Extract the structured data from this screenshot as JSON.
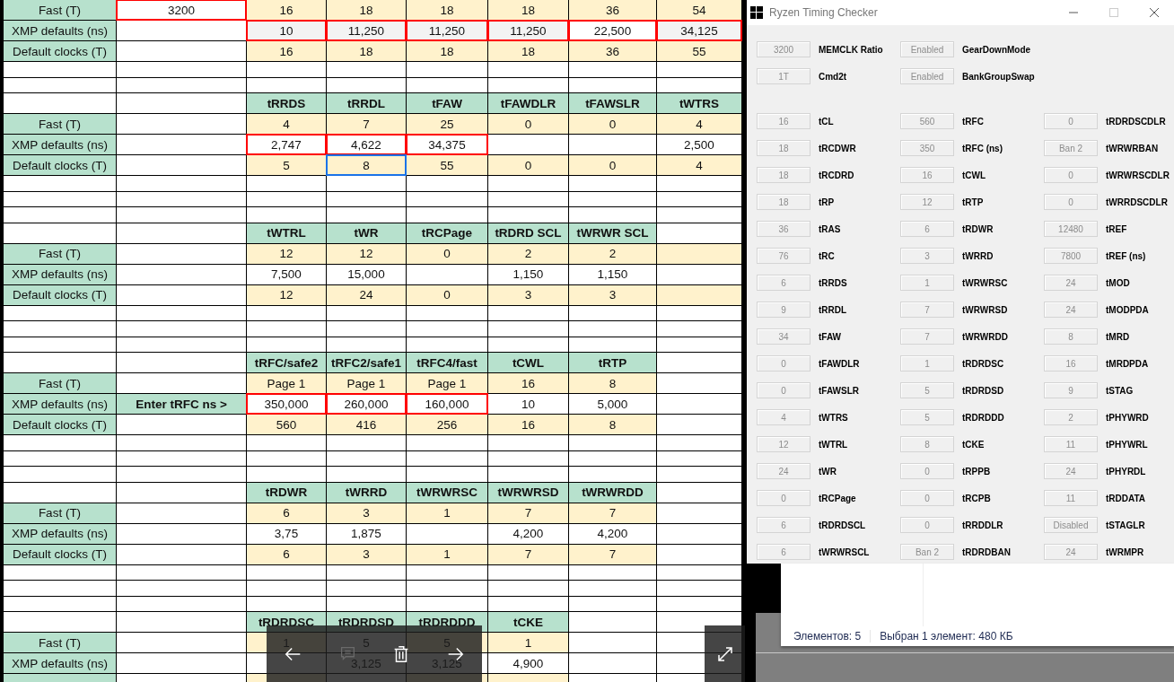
{
  "spreadsheet": {
    "blocks": [
      {
        "rows": [
          {
            "label": "Fast (T)",
            "cells": [
              {
                "text": "3200",
                "outlined": true,
                "selected": false
              },
              {
                "text": "16",
                "color": "#fff2cc",
                "outlined": false,
                "selected": false
              },
              {
                "text": "18",
                "color": "#fff2cc",
                "outlined": false,
                "selected": false
              },
              {
                "text": "18",
                "color": "#fff2cc",
                "outlined": false,
                "selected": false
              },
              {
                "text": "18",
                "color": "#fff2cc",
                "outlined": false,
                "selected": false
              },
              {
                "text": "36",
                "color": "#fff2cc",
                "outlined": false,
                "selected": false
              },
              {
                "text": "54",
                "color": "#fff2cc",
                "outlined": false,
                "selected": false
              }
            ]
          },
          {
            "label": "XMP defaults (ns)",
            "cells": [
              {
                "outlined": false,
                "selected": false
              },
              {
                "text": "10",
                "color": "#f3f3f3",
                "outlined": true,
                "selected": false
              },
              {
                "text": "11,250",
                "color": "#f3f3f3",
                "outlined": true,
                "selected": false
              },
              {
                "text": "11,250",
                "color": "#f3f3f3",
                "outlined": true,
                "selected": false
              },
              {
                "text": "11,250",
                "color": "#f3f3f3",
                "outlined": true,
                "selected": false
              },
              {
                "text": "22,500",
                "outlined": true,
                "selected": false
              },
              {
                "text": "34,125",
                "color": "#f3f3f3",
                "outlined": true,
                "selected": false
              }
            ]
          },
          {
            "label": "Default clocks (T)",
            "cells": [
              {
                "outlined": false,
                "selected": false
              },
              {
                "text": "16",
                "color": "#fff2cc",
                "outlined": false,
                "selected": false
              },
              {
                "text": "18",
                "color": "#fff2cc",
                "outlined": false,
                "selected": false
              },
              {
                "text": "18",
                "color": "#fff2cc",
                "outlined": false,
                "selected": false
              },
              {
                "text": "18",
                "color": "#fff2cc",
                "outlined": false,
                "selected": false
              },
              {
                "text": "36",
                "color": "#fff2cc",
                "outlined": false,
                "selected": false
              },
              {
                "text": "55",
                "color": "#fff2cc",
                "outlined": false,
                "selected": false
              }
            ]
          },
          {
            "kind": "blank"
          },
          {
            "kind": "blank"
          }
        ]
      },
      {
        "headers": [
          "tRRDS",
          "tRRDL",
          "tFAW",
          "tFAWDLR",
          "tFAWSLR",
          "tWTRS"
        ],
        "rows": [
          {
            "label": "Fast (T)",
            "cells": [
              {
                "outlined": false,
                "selected": false
              },
              {
                "text": "4",
                "color": "#fff2cc",
                "outlined": false,
                "selected": false
              },
              {
                "text": "7",
                "color": "#fff2cc",
                "outlined": false,
                "selected": false
              },
              {
                "text": "25",
                "color": "#fff2cc",
                "outlined": false,
                "selected": false
              },
              {
                "text": "0",
                "color": "#fff2cc",
                "outlined": false,
                "selected": false
              },
              {
                "text": "0",
                "color": "#fff2cc",
                "outlined": false,
                "selected": false
              },
              {
                "text": "4",
                "color": "#fff2cc",
                "outlined": false,
                "selected": false
              }
            ]
          },
          {
            "label": "XMP defaults (ns)",
            "cells": [
              {
                "outlined": false,
                "selected": false
              },
              {
                "text": "2,747",
                "outlined": true,
                "selected": false
              },
              {
                "text": "4,622",
                "outlined": true,
                "selected": false
              },
              {
                "text": "34,375",
                "outlined": true,
                "selected": false
              },
              {
                "outlined": false,
                "selected": false
              },
              {
                "outlined": false,
                "selected": false
              },
              {
                "text": "2,500",
                "outlined": false,
                "selected": false
              }
            ]
          },
          {
            "label": "Default clocks (T)",
            "cells": [
              {
                "outlined": false,
                "selected": false
              },
              {
                "text": "5",
                "color": "#fff2cc",
                "outlined": false,
                "selected": false
              },
              {
                "text": "8",
                "color": "#fff2cc",
                "outlined": false,
                "selected": true
              },
              {
                "text": "55",
                "color": "#fff2cc",
                "outlined": false,
                "selected": false
              },
              {
                "text": "0",
                "color": "#fff2cc",
                "outlined": false,
                "selected": false
              },
              {
                "text": "0",
                "color": "#fff2cc",
                "outlined": false,
                "selected": false
              },
              {
                "text": "4",
                "color": "#fff2cc",
                "outlined": false,
                "selected": false
              }
            ]
          },
          {
            "kind": "blank"
          },
          {
            "kind": "blank"
          },
          {
            "kind": "blank"
          }
        ]
      },
      {
        "headers": [
          "tWTRL",
          "tWR",
          "tRCPage",
          "tRDRD SCL",
          "tWRWR SCL"
        ],
        "rows": [
          {
            "label": "Fast (T)",
            "cells": [
              {
                "outlined": false,
                "selected": false
              },
              {
                "text": "12",
                "color": "#fff2cc",
                "outlined": false,
                "selected": false
              },
              {
                "text": "12",
                "color": "#fff2cc",
                "outlined": false,
                "selected": false
              },
              {
                "text": "0",
                "color": "#fff2cc",
                "outlined": false,
                "selected": false
              },
              {
                "text": "2",
                "color": "#fff2cc",
                "outlined": false,
                "selected": false
              },
              {
                "text": "2",
                "color": "#fff2cc",
                "outlined": false,
                "selected": false
              },
              {
                "color": "#fff2cc",
                "outlined": false,
                "selected": false
              }
            ]
          },
          {
            "label": "XMP defaults (ns)",
            "cells": [
              {
                "outlined": false,
                "selected": false
              },
              {
                "text": "7,500",
                "outlined": false,
                "selected": false
              },
              {
                "text": "15,000",
                "outlined": false,
                "selected": false
              },
              {
                "outlined": false,
                "selected": false
              },
              {
                "text": "1,150",
                "outlined": false,
                "selected": false
              },
              {
                "text": "1,150",
                "outlined": false,
                "selected": false
              },
              {
                "outlined": false,
                "selected": false
              }
            ]
          },
          {
            "label": "Default clocks (T)",
            "cells": [
              {
                "outlined": false,
                "selected": false
              },
              {
                "text": "12",
                "color": "#fff2cc",
                "outlined": false,
                "selected": false
              },
              {
                "text": "24",
                "color": "#fff2cc",
                "outlined": false,
                "selected": false
              },
              {
                "text": "0",
                "color": "#fff2cc",
                "outlined": false,
                "selected": false
              },
              {
                "text": "3",
                "color": "#fff2cc",
                "outlined": false,
                "selected": false
              },
              {
                "text": "3",
                "color": "#fff2cc",
                "outlined": false,
                "selected": false
              },
              {
                "color": "#fff2cc",
                "outlined": false,
                "selected": false
              }
            ]
          },
          {
            "kind": "blank"
          },
          {
            "kind": "blank"
          },
          {
            "kind": "blank"
          }
        ]
      },
      {
        "headers": [
          "tRFC/safe2",
          "tRFC2/safe1",
          "tRFC4/fast",
          "tCWL",
          "tRTP"
        ],
        "rows": [
          {
            "label": "Fast (T)",
            "cells": [
              {
                "outlined": false,
                "selected": false
              },
              {
                "text": "Page 1",
                "color": "#fff2cc",
                "outlined": false,
                "selected": false
              },
              {
                "text": "Page 1",
                "color": "#fff2cc",
                "outlined": false,
                "selected": false
              },
              {
                "text": "Page 1",
                "color": "#fff2cc",
                "outlined": false,
                "selected": false
              },
              {
                "text": "16",
                "color": "#fff2cc",
                "outlined": false,
                "selected": false
              },
              {
                "text": "8",
                "color": "#fff2cc",
                "outlined": false,
                "selected": false
              },
              {
                "outlined": false,
                "selected": false
              }
            ]
          },
          {
            "label": "XMP defaults (ns)",
            "cells": [
              {
                "text": "Enter tRFC ns >",
                "color": "#b7e1cd",
                "outlined": false,
                "selected": false
              },
              {
                "text": "350,000",
                "outlined": true,
                "selected": false
              },
              {
                "text": "260,000",
                "outlined": true,
                "selected": false
              },
              {
                "text": "160,000",
                "outlined": true,
                "selected": false
              },
              {
                "text": "10",
                "outlined": false,
                "selected": false
              },
              {
                "text": "5,000",
                "outlined": false,
                "selected": false
              },
              {
                "outlined": false,
                "selected": false
              }
            ]
          },
          {
            "label": "Default clocks (T)",
            "cells": [
              {
                "outlined": false,
                "selected": false
              },
              {
                "text": "560",
                "color": "#fff2cc",
                "outlined": false,
                "selected": false
              },
              {
                "text": "416",
                "color": "#fff2cc",
                "outlined": false,
                "selected": false
              },
              {
                "text": "256",
                "color": "#fff2cc",
                "outlined": false,
                "selected": false
              },
              {
                "text": "16",
                "color": "#fff2cc",
                "outlined": false,
                "selected": false
              },
              {
                "text": "8",
                "color": "#fff2cc",
                "outlined": false,
                "selected": false
              },
              {
                "outlined": false,
                "selected": false
              }
            ]
          },
          {
            "kind": "blank"
          },
          {
            "kind": "blank"
          },
          {
            "kind": "blank"
          }
        ]
      },
      {
        "headers": [
          "tRDWR",
          "tWRRD",
          "tWRWRSC",
          "tWRWRSD",
          "tWRWRDD"
        ],
        "rows": [
          {
            "label": "Fast (T)",
            "cells": [
              {
                "outlined": false,
                "selected": false
              },
              {
                "text": "6",
                "color": "#fff2cc",
                "outlined": false,
                "selected": false
              },
              {
                "text": "3",
                "color": "#fff2cc",
                "outlined": false,
                "selected": false
              },
              {
                "text": "1",
                "color": "#fff2cc",
                "outlined": false,
                "selected": false
              },
              {
                "text": "7",
                "color": "#fff2cc",
                "outlined": false,
                "selected": false
              },
              {
                "text": "7",
                "color": "#fff2cc",
                "outlined": false,
                "selected": false
              },
              {
                "outlined": false,
                "selected": false
              }
            ]
          },
          {
            "label": "XMP defaults (ns)",
            "cells": [
              {
                "outlined": false,
                "selected": false
              },
              {
                "text": "3,75",
                "outlined": false,
                "selected": false
              },
              {
                "text": "1,875",
                "outlined": false,
                "selected": false
              },
              {
                "outlined": false,
                "selected": false
              },
              {
                "text": "4,200",
                "outlined": false,
                "selected": false
              },
              {
                "text": "4,200",
                "outlined": false,
                "selected": false
              },
              {
                "outlined": false,
                "selected": false
              }
            ]
          },
          {
            "label": "Default clocks (T)",
            "cells": [
              {
                "outlined": false,
                "selected": false
              },
              {
                "text": "6",
                "color": "#fff2cc",
                "outlined": false,
                "selected": false
              },
              {
                "text": "3",
                "color": "#fff2cc",
                "outlined": false,
                "selected": false
              },
              {
                "text": "1",
                "color": "#fff2cc",
                "outlined": false,
                "selected": false
              },
              {
                "text": "7",
                "color": "#fff2cc",
                "outlined": false,
                "selected": false
              },
              {
                "text": "7",
                "color": "#fff2cc",
                "outlined": false,
                "selected": false
              },
              {
                "outlined": false,
                "selected": false
              }
            ]
          },
          {
            "kind": "blank"
          },
          {
            "kind": "blank"
          },
          {
            "kind": "blank"
          }
        ]
      },
      {
        "headers": [
          "tRDRDSC",
          "tRDRDSD",
          "tRDRDDD",
          "tCKE"
        ],
        "rows": [
          {
            "label": "Fast (T)",
            "cells": [
              {
                "outlined": false,
                "selected": false
              },
              {
                "text": "1",
                "color": "#fff2cc",
                "outlined": false,
                "selected": false
              },
              {
                "text": "5",
                "outlined": false,
                "selected": false
              },
              {
                "text": "5",
                "color": "#fff2cc",
                "outlined": false,
                "selected": false
              },
              {
                "text": "1",
                "color": "#fff2cc",
                "outlined": false,
                "selected": false
              },
              {
                "outlined": false,
                "selected": false
              },
              {
                "outlined": false,
                "selected": false
              }
            ]
          },
          {
            "label": "XMP defaults (ns)",
            "cells": [
              {
                "outlined": false,
                "selected": false
              },
              {
                "outlined": false,
                "selected": false
              },
              {
                "text": "3,125",
                "outlined": false,
                "selected": false
              },
              {
                "text": "3,125",
                "outlined": false,
                "selected": false
              },
              {
                "text": "4,900",
                "outlined": false,
                "selected": false
              },
              {
                "outlined": false,
                "selected": false
              },
              {
                "outlined": false,
                "selected": false
              }
            ]
          },
          {
            "cells": [
              {
                "outlined": false,
                "selected": false
              },
              {
                "color": "#fff2cc",
                "outlined": false,
                "selected": false
              },
              {
                "outlined": false,
                "selected": false
              },
              {
                "color": "#fff2cc",
                "outlined": false,
                "selected": false
              },
              {
                "color": "#fff2cc",
                "outlined": false,
                "selected": false
              },
              {
                "outlined": false,
                "selected": false
              },
              {
                "outlined": false,
                "selected": false
              }
            ]
          }
        ]
      }
    ]
  },
  "viewer_toolbar": {
    "buttons": [
      {
        "kind": "previous",
        "disabled": false
      },
      {
        "kind": "comment",
        "disabled": true
      },
      {
        "kind": "delete",
        "disabled": false
      },
      {
        "kind": "next",
        "disabled": false
      }
    ]
  },
  "checker": {
    "window": {
      "title": "Ryzen Timing Checker"
    },
    "top_rows": [
      [
        {
          "reading": "3200",
          "label": "MEMCLK Ratio"
        },
        {
          "reading": "Enabled",
          "label": "GearDownMode"
        }
      ],
      [
        {
          "reading": "1T",
          "label": "Cmd2t"
        },
        {
          "reading": "Enabled",
          "label": "BankGroupSwap"
        }
      ]
    ],
    "rows": [
      [
        {
          "reading": "16",
          "label": "tCL"
        },
        {
          "reading": "560",
          "label": "tRFC"
        },
        {
          "reading": "0",
          "label": "tRDRDSCDLR"
        }
      ],
      [
        {
          "reading": "18",
          "label": "tRCDWR"
        },
        {
          "reading": "350",
          "label": "tRFC (ns)"
        },
        {
          "reading": "Ban 2",
          "label": "tWRWRBAN"
        }
      ],
      [
        {
          "reading": "18",
          "label": "tRCDRD"
        },
        {
          "reading": "16",
          "label": "tCWL"
        },
        {
          "reading": "0",
          "label": "tWRWRSCDLR"
        }
      ],
      [
        {
          "reading": "18",
          "label": "tRP"
        },
        {
          "reading": "12",
          "label": "tRTP"
        },
        {
          "reading": "0",
          "label": "tWRRDSCDLR"
        }
      ],
      [
        {
          "reading": "36",
          "label": "tRAS"
        },
        {
          "reading": "6",
          "label": "tRDWR"
        },
        {
          "reading": "12480",
          "label": "tREF"
        }
      ],
      [
        {
          "reading": "76",
          "label": "tRC"
        },
        {
          "reading": "3",
          "label": "tWRRD"
        },
        {
          "reading": "7800",
          "label": "tREF (ns)"
        }
      ],
      [
        {
          "reading": "6",
          "label": "tRRDS"
        },
        {
          "reading": "1",
          "label": "tWRWRSC"
        },
        {
          "reading": "24",
          "label": "tMOD"
        }
      ],
      [
        {
          "reading": "9",
          "label": "tRRDL"
        },
        {
          "reading": "7",
          "label": "tWRWRSD"
        },
        {
          "reading": "24",
          "label": "tMODPDA"
        }
      ],
      [
        {
          "reading": "34",
          "label": "tFAW"
        },
        {
          "reading": "7",
          "label": "tWRWRDD"
        },
        {
          "reading": "8",
          "label": "tMRD"
        }
      ],
      [
        {
          "reading": "0",
          "label": "tFAWDLR"
        },
        {
          "reading": "1",
          "label": "tRDRDSC"
        },
        {
          "reading": "16",
          "label": "tMRDPDA"
        }
      ],
      [
        {
          "reading": "0",
          "label": "tFAWSLR"
        },
        {
          "reading": "5",
          "label": "tRDRDSD"
        },
        {
          "reading": "9",
          "label": "tSTAG"
        }
      ],
      [
        {
          "reading": "4",
          "label": "tWTRS"
        },
        {
          "reading": "5",
          "label": "tRDRDDD"
        },
        {
          "reading": "2",
          "label": "tPHYWRD"
        }
      ],
      [
        {
          "reading": "12",
          "label": "tWTRL"
        },
        {
          "reading": "8",
          "label": "tCKE"
        },
        {
          "reading": "11",
          "label": "tPHYWRL"
        }
      ],
      [
        {
          "reading": "24",
          "label": "tWR"
        },
        {
          "reading": "0",
          "label": "tRPPB"
        },
        {
          "reading": "24",
          "label": "tPHYRDL"
        }
      ],
      [
        {
          "reading": "0",
          "label": "tRCPage"
        },
        {
          "reading": "0",
          "label": "tRCPB"
        },
        {
          "reading": "11",
          "label": "tRDDATA"
        }
      ],
      [
        {
          "reading": "6",
          "label": "tRDRDSCL"
        },
        {
          "reading": "0",
          "label": "tRRDDLR"
        },
        {
          "reading": "Disabled",
          "label": "tSTAGLR"
        }
      ],
      [
        {
          "reading": "6",
          "label": "tWRWRSCL"
        },
        {
          "reading": "Ban 2",
          "label": "tRDRDBAN"
        },
        {
          "reading": "24",
          "label": "tWRMPR"
        }
      ]
    ]
  },
  "explorer": {
    "status_bar": [
      "Элементов: 5",
      "Выбран 1 элемент: 480 КБ"
    ]
  }
}
